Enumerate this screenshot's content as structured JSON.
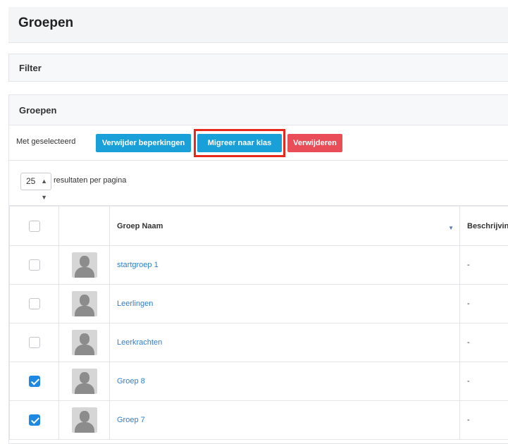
{
  "header": {
    "title": "Groepen"
  },
  "filter": {
    "title": "Filter"
  },
  "groups_panel": {
    "title": "Groepen",
    "bulk": {
      "label": "Met geselecteerd",
      "remove_limits": "Verwijder beperkingen",
      "migrate": "Migreer naar klas",
      "delete": "Verwijderen"
    },
    "per_page": {
      "value": "25",
      "label": "resultaten per pagina"
    },
    "columns": {
      "name": "Groep Naam",
      "description": "Beschrijving"
    },
    "rows": [
      {
        "name": "startgroep 1",
        "description": "-",
        "checked": false
      },
      {
        "name": "Leerlingen",
        "description": "-",
        "checked": false
      },
      {
        "name": "Leerkrachten",
        "description": "-",
        "checked": false
      },
      {
        "name": "Groep 8",
        "description": "-",
        "checked": true
      },
      {
        "name": "Groep 7",
        "description": "-",
        "checked": true
      }
    ]
  },
  "colors": {
    "info": "#1aa0d8",
    "danger": "#e94d58",
    "highlight": "#e6291b",
    "link": "#2d7fd2",
    "checked": "#1e88e5"
  },
  "icons": {
    "sort": "sort-down-icon",
    "avatar": "user-placeholder-icon",
    "select": "up-down-arrows-icon"
  }
}
